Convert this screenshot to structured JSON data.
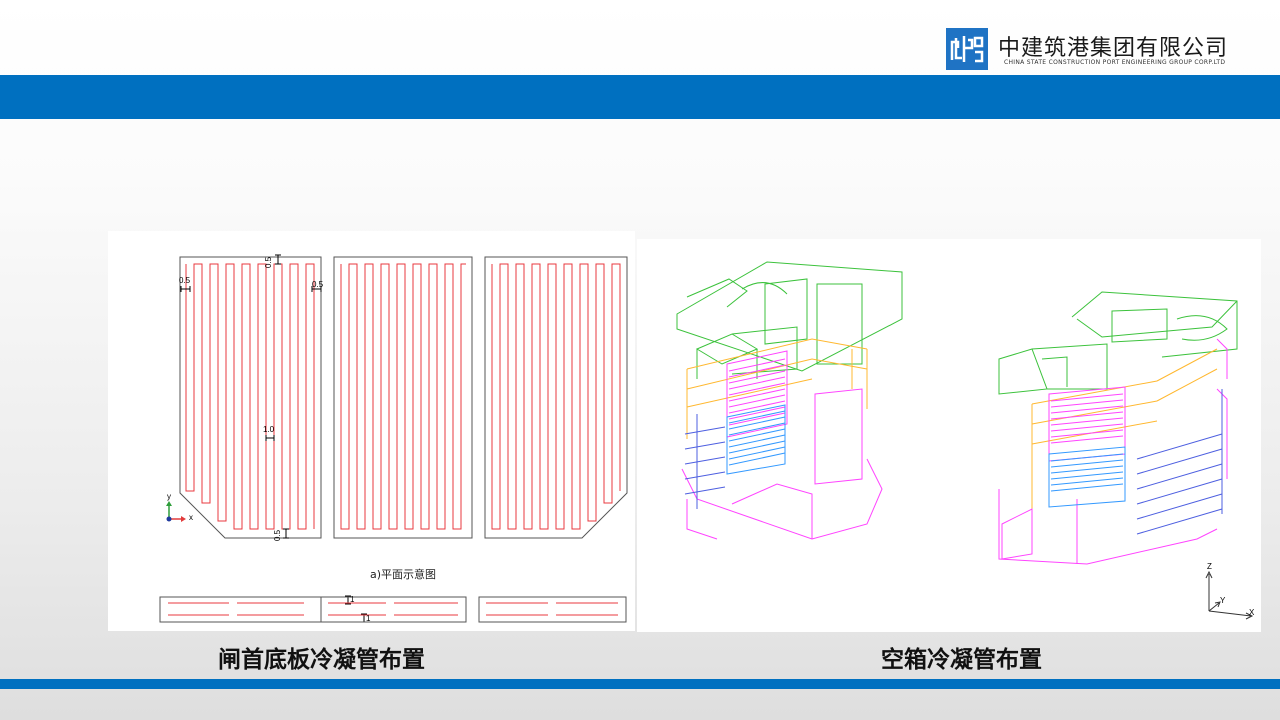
{
  "header": {
    "company_name_cn": "中建筑港集团有限公司",
    "company_name_en": "CHINA STATE CONSTRUCTION PORT ENGINEERING GROUP CORP.LTD"
  },
  "figures": {
    "plan": {
      "subcaption": "a)平面示意图",
      "dim_labels": [
        "0.5",
        "0.5",
        "0.5",
        "1.0",
        "0.5",
        "1",
        "1"
      ],
      "axis_x": "x",
      "axis_y": "y"
    },
    "iso": {
      "axis_x": "X",
      "axis_y": "Y",
      "axis_z": "Z"
    }
  },
  "captions": {
    "left": "闸首底板冷凝管布置",
    "right": "空箱冷凝管布置"
  },
  "colors": {
    "brand_blue": "#0070c0",
    "pipe_red": "#e8393f",
    "outline_gray": "#555555",
    "iso_green": "#3cc23c",
    "iso_magenta": "#ff44ff",
    "iso_cyan": "#3399ff",
    "iso_orange": "#ffb830",
    "iso_blue": "#4d5fe0"
  }
}
